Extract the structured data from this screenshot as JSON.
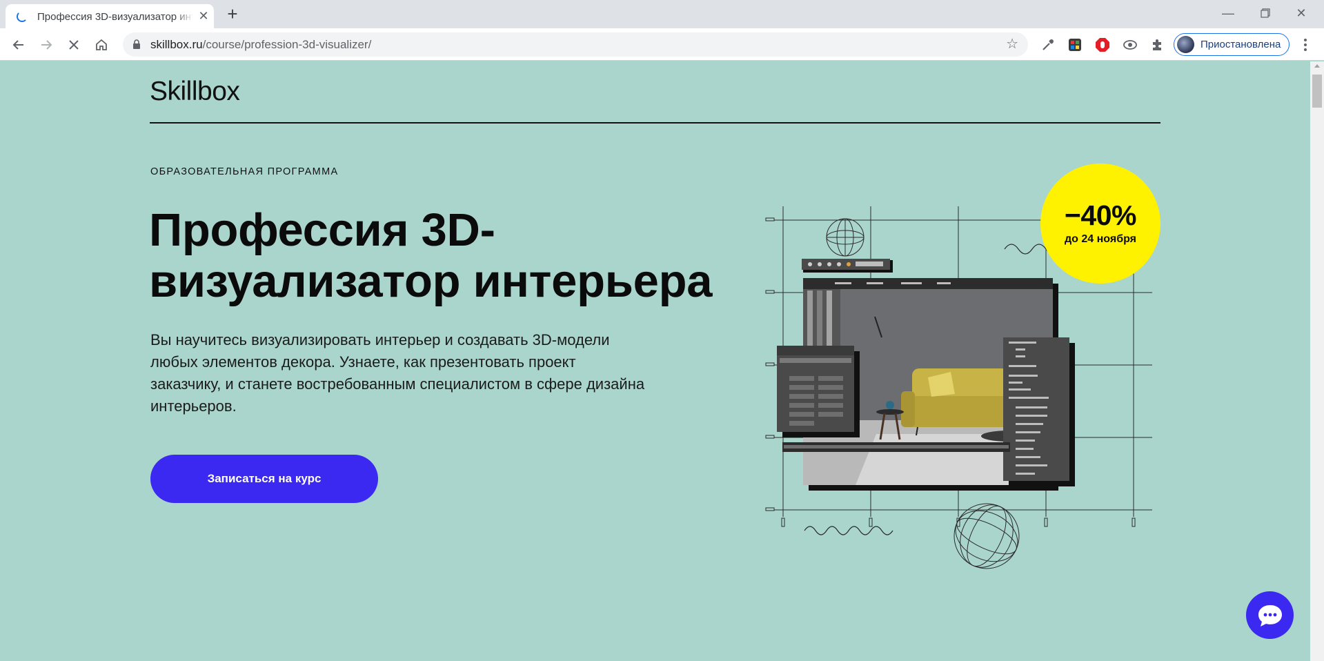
{
  "browser": {
    "tab_title": "Профессия 3D-визуализатор интерьера",
    "url_domain": "skillbox.ru",
    "url_path": "/course/profession-3d-visualizer/",
    "profile_label": "Приостановлена"
  },
  "page": {
    "logo": "Skillbox",
    "eyebrow": "ОБРАЗОВАТЕЛЬНАЯ ПРОГРАММА",
    "headline": "Профессия 3D-визуализатор интерьера",
    "lead": "Вы научитесь визуализировать интерьер и создавать 3D-модели любых элементов декора. Узнаете, как презентовать проект заказчику, и станете востребованным специалистом в сфере дизайна интерьеров.",
    "cta_label": "Записаться на курс",
    "sale": {
      "percent": "−40%",
      "until": "до 24 ноября"
    }
  },
  "colors": {
    "page_bg": "#aad5cc",
    "cta_bg": "#3b28f1",
    "sale_bg": "#fff200"
  },
  "icons": [
    "loading-spinner-icon",
    "close-icon",
    "plus-icon",
    "minimize-icon",
    "restore-icon",
    "back-arrow-icon",
    "forward-arrow-icon",
    "stop-icon",
    "home-icon",
    "lock-icon",
    "star-icon",
    "eyedropper-icon",
    "color-extension-icon",
    "adblock-icon",
    "eye-extension-icon",
    "puzzle-icon",
    "kebab-menu-icon",
    "chat-icon"
  ]
}
